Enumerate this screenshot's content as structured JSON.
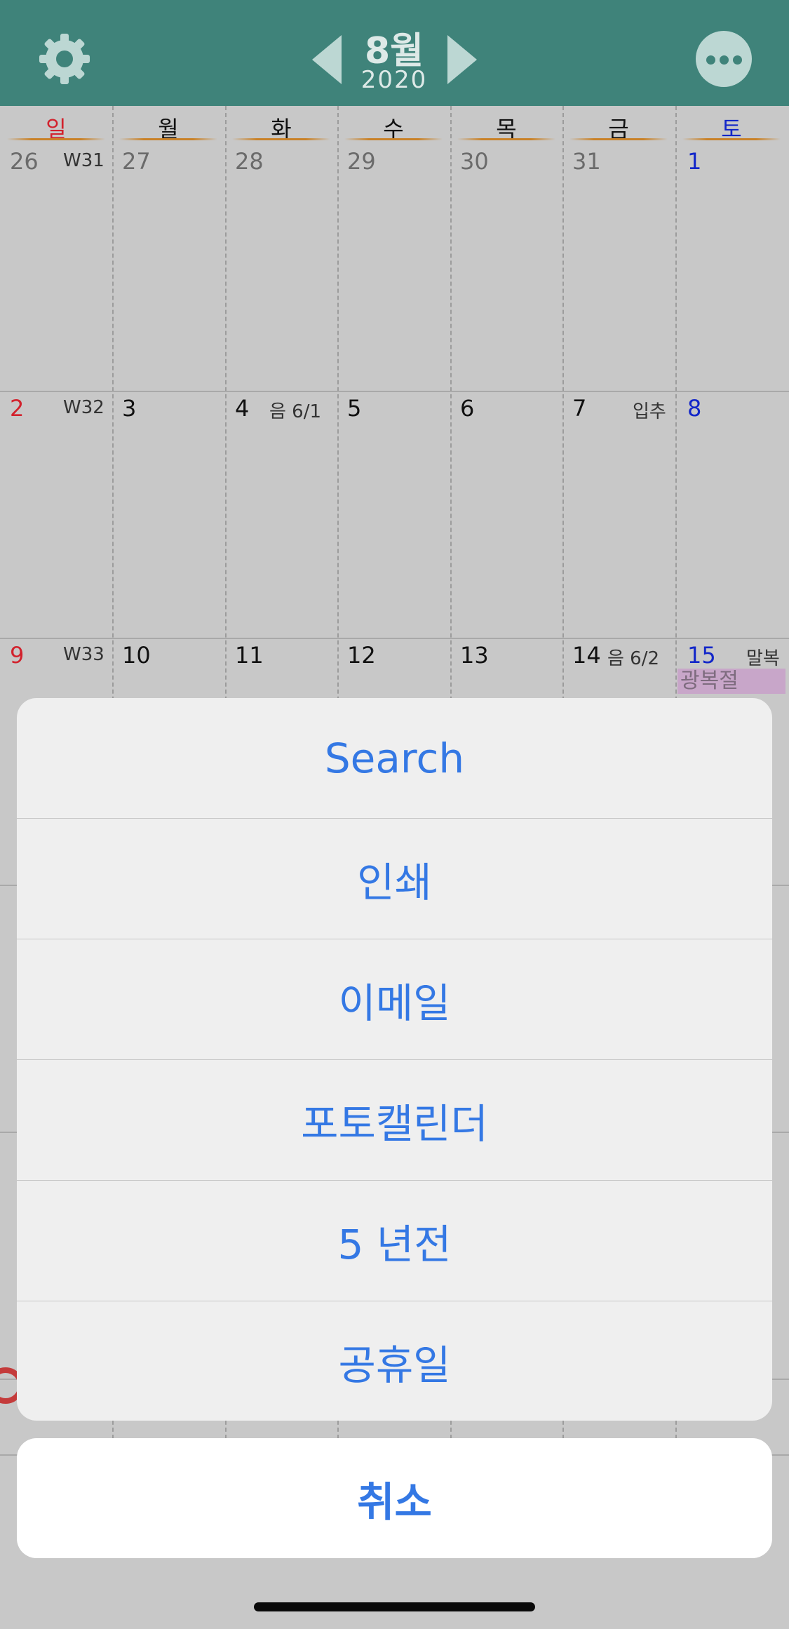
{
  "header": {
    "month": "8월",
    "year": "2020"
  },
  "weekdays": [
    "일",
    "월",
    "화",
    "수",
    "목",
    "금",
    "토"
  ],
  "weeks": [
    {
      "week_label": "W31",
      "days": [
        "26",
        "27",
        "28",
        "29",
        "30",
        "31",
        "1"
      ]
    },
    {
      "week_label": "W32",
      "days": [
        "2",
        "3",
        "4",
        "5",
        "6",
        "7",
        "8"
      ],
      "notes": {
        "tue": "음 6/1",
        "fri": "입추"
      }
    },
    {
      "week_label": "W33",
      "days": [
        "9",
        "10",
        "11",
        "12",
        "13",
        "14",
        "15"
      ],
      "notes": {
        "fri": "음 6/2",
        "sat": "말복"
      },
      "events": {
        "sat": "광복절"
      }
    }
  ],
  "action_sheet": {
    "items": [
      "Search",
      "인쇄",
      "이메일",
      "포토캘린더",
      "5 년전",
      "공휴일"
    ],
    "cancel": "취소"
  },
  "colors": {
    "header": "#3f837a",
    "sunday": "#d2222d",
    "saturday": "#1226c9",
    "action": "#3478e4",
    "holiday_bg": "#c8a6c9"
  }
}
